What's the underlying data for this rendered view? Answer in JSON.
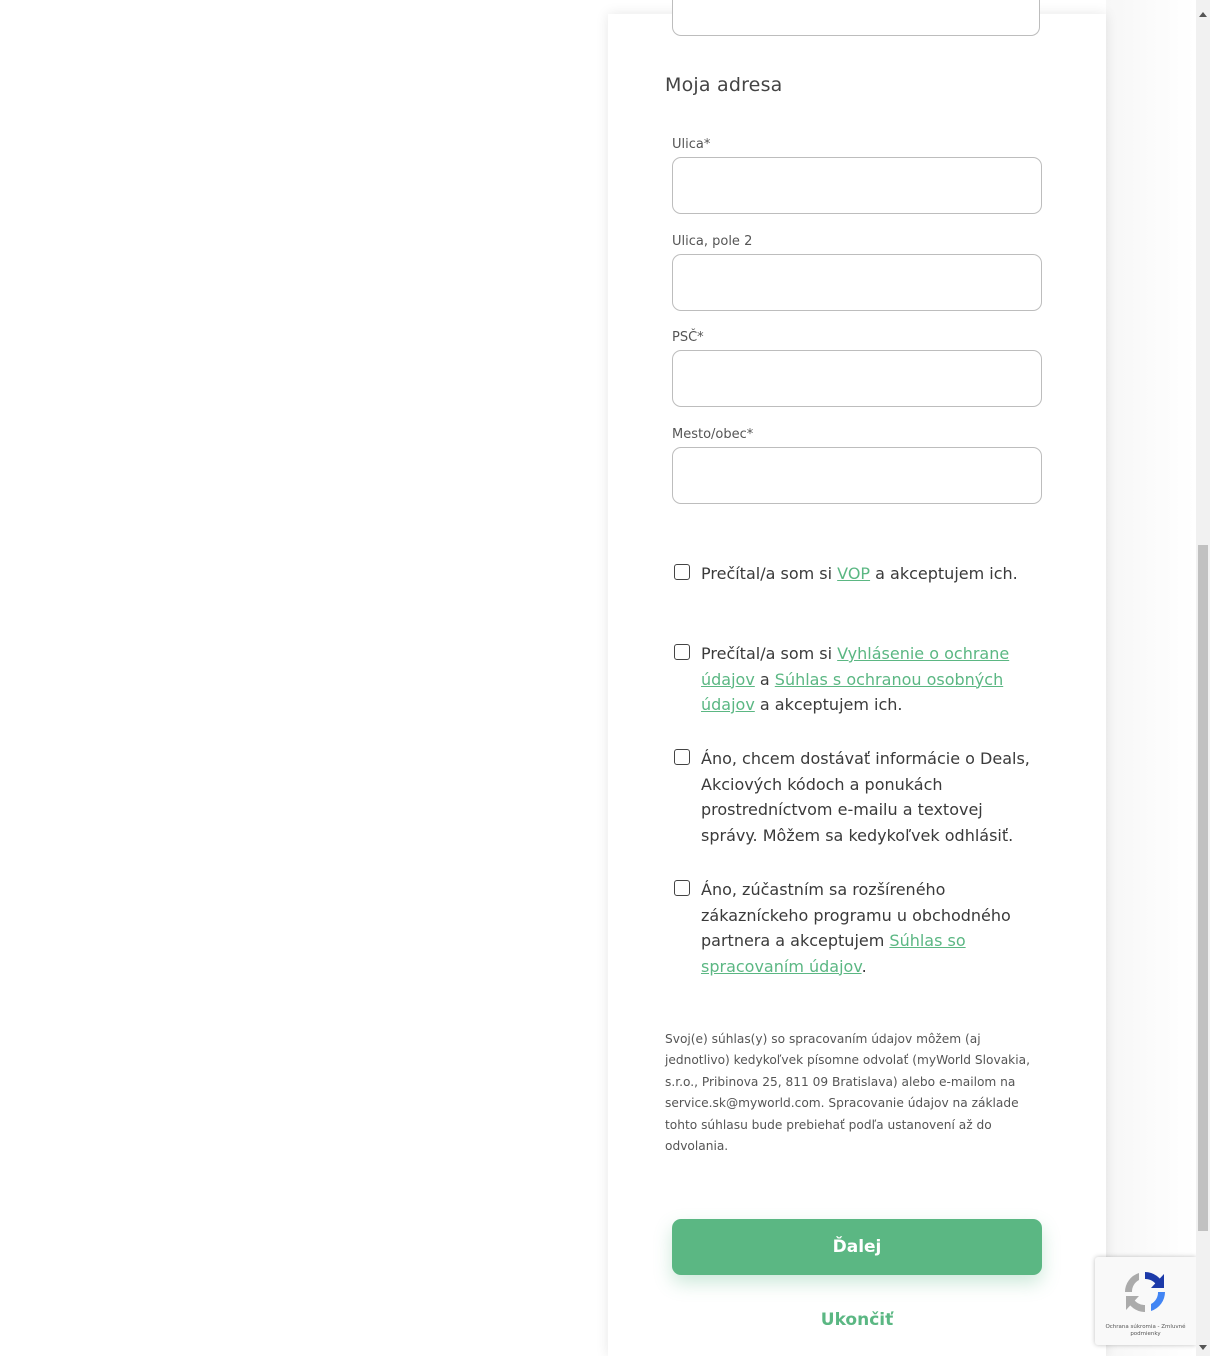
{
  "address": {
    "section_title": "Moja adresa",
    "fields": [
      {
        "label": "Ulica*",
        "value": ""
      },
      {
        "label": "Ulica, pole 2",
        "value": ""
      },
      {
        "label": "PSČ*",
        "value": ""
      },
      {
        "label": "Mesto/obec*",
        "value": ""
      }
    ]
  },
  "consents": [
    {
      "checked": false,
      "t1": "Prečítal/a som si ",
      "link1": "VOP",
      "t2": " a akceptujem ich."
    },
    {
      "checked": false,
      "t1": "Prečítal/a som si ",
      "link1": "Vyhlásenie o ochrane údajov",
      "t2": " a ",
      "link2": "Súhlas s ochranou osobných údajov",
      "t3": " a akceptujem ich."
    },
    {
      "checked": false,
      "t1": "Áno, chcem dostávať informácie o Deals, Akciových kódoch a ponukách prostredníctvom e-mailu a textovej správy. Môžem sa kedykoľvek odhlásiť."
    },
    {
      "checked": false,
      "t1": "Áno, zúčastním sa rozšíreného zákazníckeho programu u obchodného partnera a akceptujem ",
      "link1": "Súhlas so spracovaním údajov",
      "t2": "."
    }
  ],
  "disclaimer": "Svoj(e) súhlas(y) so spracovaním údajov môžem (aj jednotlivo) kedykoľvek písomne odvolať (myWorld Slovakia, s.r.o., Pribinova 25, 811 09 Bratislava) alebo e-mailom na service.sk@myworld.com. Spracovanie údajov na základe tohto súhlasu bude prebiehať podľa ustanovení až do odvolania.",
  "actions": {
    "next_label": "Ďalej",
    "exit_label": "Ukončiť"
  },
  "recaptcha": {
    "text": "Ochrana súkromia - Zmluvné podmienky"
  },
  "colors": {
    "accent": "#5bb783",
    "border": "#bdbdbd",
    "text": "#3a3a3a"
  }
}
